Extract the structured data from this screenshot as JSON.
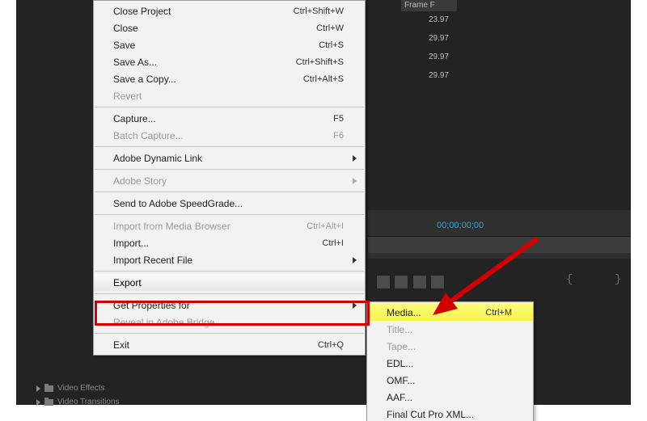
{
  "frame_header": "Frame F",
  "numbers": [
    "23.97",
    "29.97",
    "29.97",
    "29.97"
  ],
  "timecode": "00;00;00;00",
  "sidebar": {
    "video_effects": "Video Effects",
    "video_transitions": "Video Transitions"
  },
  "menu": {
    "close_project": {
      "label": "Close Project",
      "shortcut": "Ctrl+Shift+W"
    },
    "close": {
      "label": "Close",
      "shortcut": "Ctrl+W"
    },
    "save": {
      "label": "Save",
      "shortcut": "Ctrl+S"
    },
    "save_as": {
      "label": "Save As...",
      "shortcut": "Ctrl+Shift+S"
    },
    "save_copy": {
      "label": "Save a Copy...",
      "shortcut": "Ctrl+Alt+S"
    },
    "revert": {
      "label": "Revert"
    },
    "capture": {
      "label": "Capture...",
      "shortcut": "F5"
    },
    "batch_capture": {
      "label": "Batch Capture...",
      "shortcut": "F6"
    },
    "dynamic_link": {
      "label": "Adobe Dynamic Link"
    },
    "story": {
      "label": "Adobe Story"
    },
    "speedgrade": {
      "label": "Send to Adobe SpeedGrade..."
    },
    "import_browser": {
      "label": "Import from Media Browser",
      "shortcut": "Ctrl+Alt+I"
    },
    "import": {
      "label": "Import...",
      "shortcut": "Ctrl+I"
    },
    "import_recent": {
      "label": "Import Recent File"
    },
    "export": {
      "label": "Export"
    },
    "get_props": {
      "label": "Get Properties for"
    },
    "reveal_bridge": {
      "label": "Reveal in Adobe Bridge..."
    },
    "exit": {
      "label": "Exit",
      "shortcut": "Ctrl+Q"
    }
  },
  "submenu": {
    "media": {
      "label": "Media...",
      "shortcut": "Ctrl+M"
    },
    "title": {
      "label": "Title..."
    },
    "tape": {
      "label": "Tape..."
    },
    "edl": {
      "label": "EDL..."
    },
    "omf": {
      "label": "OMF..."
    },
    "aaf": {
      "label": "AAF..."
    },
    "fcp": {
      "label": "Final Cut Pro XML..."
    }
  }
}
